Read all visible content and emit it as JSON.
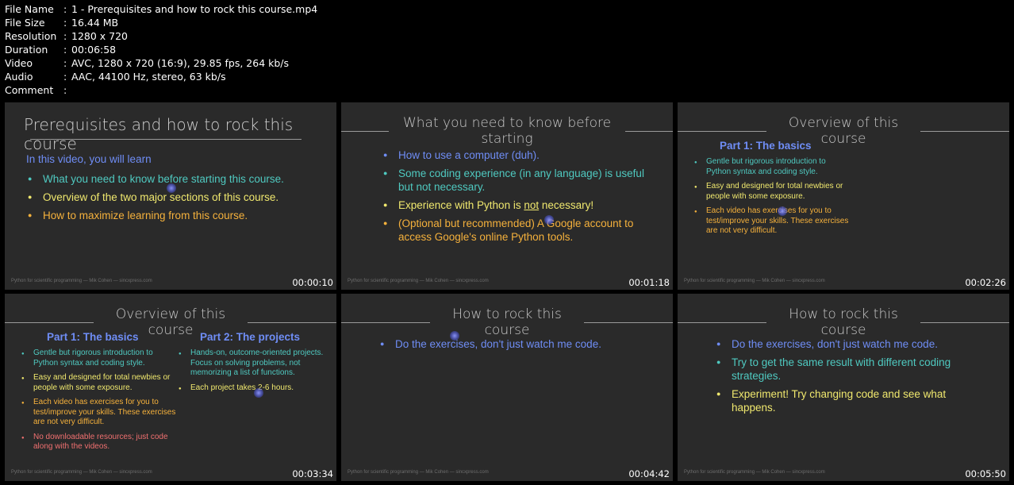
{
  "info": [
    {
      "label": "File Name",
      "value": "1 - Prerequisites and how to rock this course.mp4"
    },
    {
      "label": "File Size",
      "value": "16.44 MB"
    },
    {
      "label": "Resolution",
      "value": "1280 x 720"
    },
    {
      "label": "Duration",
      "value": "00:06:58"
    },
    {
      "label": "Video",
      "value": "AVC, 1280 x 720 (16:9), 29.85 fps, 264 kb/s"
    },
    {
      "label": "Audio",
      "value": "AAC, 44100 Hz, stereo, 63 kb/s"
    },
    {
      "label": "Comment",
      "value": ""
    }
  ],
  "separator": ":",
  "footer": "Python for scientific programming — Mik Cohen — sincxpress.com",
  "thumbs": [
    {
      "timestamp": "00:00:10",
      "title": "Prerequisites and how to rock this course",
      "intro": "In this video, you will learn",
      "bullets": [
        "What you need to know before starting this course.",
        "Overview of the two major sections of this course.",
        "How to maximize learning from this course."
      ]
    },
    {
      "timestamp": "00:01:18",
      "title": "What you need to know before starting",
      "bullets": [
        "How to use a computer (duh).",
        "Some coding experience (in any language) is useful but not necessary.",
        "Experience with Python is ",
        "(Optional but recommended) A Google account to access Google's online Python tools."
      ],
      "underlined": "not",
      "bullet3_tail": " necessary!"
    },
    {
      "timestamp": "00:02:26",
      "title": "Overview of this course",
      "part1": "Part 1: The basics",
      "bullets": [
        "Gentle but rigorous introduction to Python syntax and coding style.",
        "Easy and designed for total newbies or people with some exposure.",
        "Each video has exercises for you to test/improve your skills. These exercises are not very difficult."
      ]
    },
    {
      "timestamp": "00:03:34",
      "title": "Overview of this course",
      "part1": "Part 1: The basics",
      "part2": "Part 2: The projects",
      "bullets1": [
        "Gentle but rigorous introduction to Python syntax and coding style.",
        "Easy and designed for total newbies or people with some exposure.",
        "Each video has exercises for you to test/improve your skills. These exercises are not very difficult.",
        "No downloadable resources; just code along with the videos."
      ],
      "bullets2": [
        "Hands-on, outcome-oriented projects. Focus on solving problems, not memorizing a list of functions.",
        "Each project takes 2-6 hours."
      ]
    },
    {
      "timestamp": "00:04:42",
      "title": "How to rock this course",
      "bullets": [
        "Do the exercises, don't just watch me code."
      ]
    },
    {
      "timestamp": "00:05:50",
      "title": "How to rock this course",
      "bullets": [
        "Do the exercises, don't just watch me code.",
        "Try to get the same result with different coding strategies.",
        "Experiment! Try changing code and see what happens."
      ]
    }
  ]
}
